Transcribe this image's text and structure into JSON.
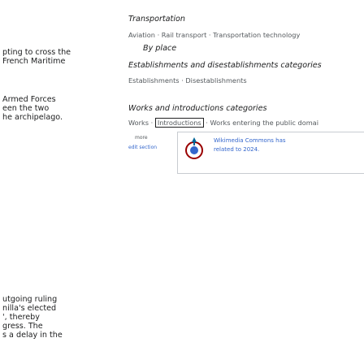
{
  "left_column": {
    "lines": [
      "pting to cross the",
      "French Maritime",
      "Armed Forces",
      "een the two",
      "he archipelago.",
      "utgoing ruling",
      "nilla's elected",
      "', thereby",
      "gress. The",
      "s a delay in the"
    ]
  },
  "right_column": {
    "transportation_heading": "Transportation",
    "transportation_categories": [
      "Aviation",
      "Rail transport",
      "Transportation technology"
    ],
    "by_place_heading": "By place",
    "establishments_heading": "Establishments and disestablishments categories",
    "establishments_categories": [
      "Establishments",
      "Disestablishments"
    ],
    "works_heading": "Works and introductions categories",
    "works_items": [
      "Works",
      "Introductions",
      "Works entering the public domai"
    ],
    "more_label": "more",
    "edit_section_label": "edit section",
    "commons_text_line1": "Wikimedia Commons has",
    "commons_text_line2": "related to 2024."
  },
  "colors": {
    "link": "#3366cc",
    "border": "#c8ccd1",
    "muted": "#54595d"
  },
  "icons": [
    "commons-icon"
  ]
}
